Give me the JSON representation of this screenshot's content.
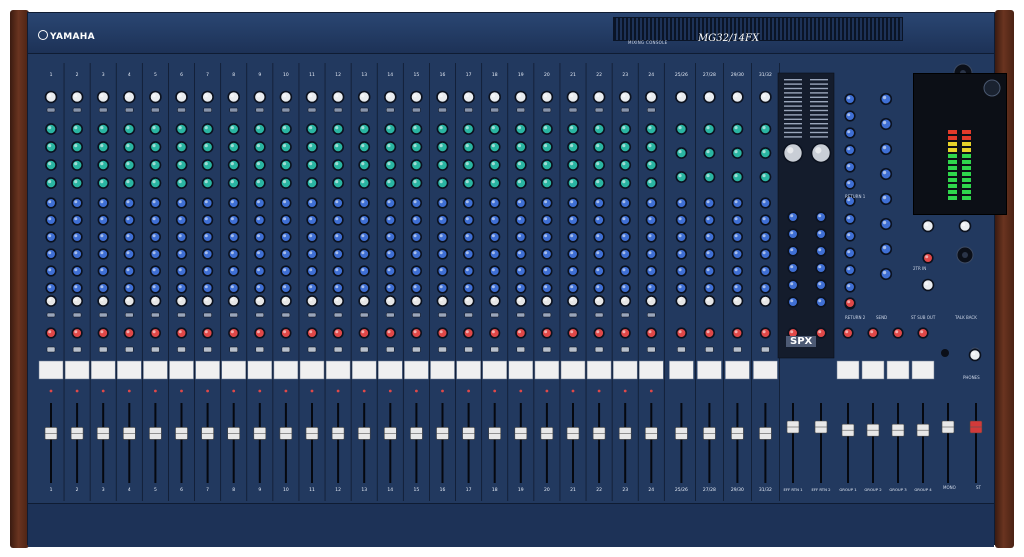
{
  "brand": "YAMAHA",
  "subtitle": "MIXING CONSOLE",
  "model": "MG32/14FX",
  "channel_numbers": [
    "1",
    "2",
    "3",
    "4",
    "5",
    "6",
    "7",
    "8",
    "9",
    "10",
    "11",
    "12",
    "13",
    "14",
    "15",
    "16",
    "17",
    "18",
    "19",
    "20",
    "21",
    "22",
    "23",
    "24"
  ],
  "stereo_pairs": [
    "25/26",
    "27/28",
    "29/30",
    "31/32"
  ],
  "effects_logo": "SPX",
  "returns": [
    "EFF RTN 1",
    "EFF RTN 2"
  ],
  "groups": [
    "GROUP 1",
    "GROUP 2",
    "GROUP 3",
    "GROUP 4"
  ],
  "section_labels": {
    "return1": "RETURN 1",
    "return2": "RETURN 2",
    "send": "SEND",
    "st_sub_out": "ST SUB OUT",
    "talkback": "TALK BACK",
    "st_in": "2TR IN",
    "phones": "PHONES"
  },
  "mono": "MONO",
  "st": "ST",
  "colors": {
    "panel": "#22395f",
    "knob_cap": "#e9ecef",
    "knob_eq": "#2ab5a2",
    "knob_aux": "#3f6fd4",
    "knob_pan": "#e6e6e6",
    "button_red": "#e04848",
    "fader_cap": "#e8e8e8",
    "fader_st": "#d23a3a",
    "meter_green": "#2fd64c",
    "meter_yellow": "#e6d22a",
    "meter_red": "#e23a2a"
  }
}
